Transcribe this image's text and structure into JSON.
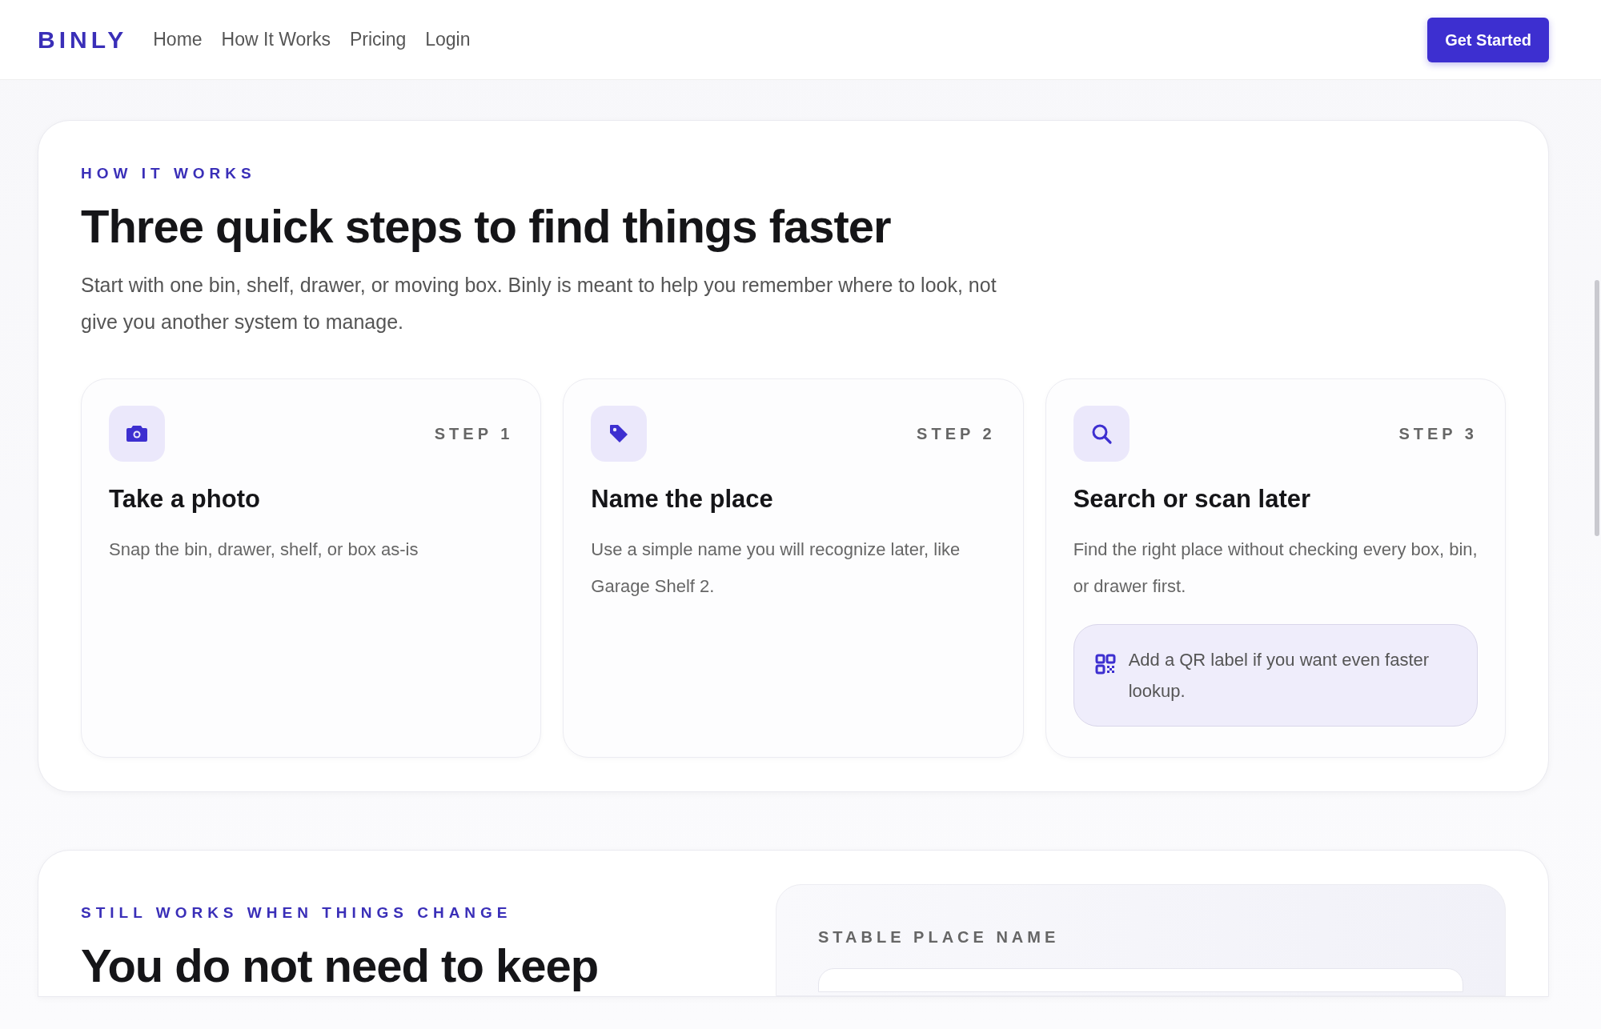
{
  "nav": {
    "brand": "BINLY",
    "links": [
      {
        "label": "Home"
      },
      {
        "label": "How It Works"
      },
      {
        "label": "Pricing"
      },
      {
        "label": "Login"
      }
    ],
    "cta": "Get Started"
  },
  "how_it_works": {
    "eyebrow": "HOW IT WORKS",
    "title": "Three quick steps to find things faster",
    "intro": "Start with one bin, shelf, drawer, or moving box. Binly is meant to help you remember where to look, not give you another system to manage.",
    "steps": [
      {
        "kind": "camera",
        "step": "STEP 1",
        "title": "Take a photo",
        "text": "Snap the bin, drawer, shelf, or box as-is"
      },
      {
        "kind": "tag",
        "step": "STEP 2",
        "title": "Name the place",
        "text": "Use a simple name you will recognize later, like Garage Shelf 2."
      },
      {
        "kind": "search",
        "step": "STEP 3",
        "title": "Search or scan later",
        "text": "Find the right place without checking every box, bin, or drawer first.",
        "tip": "Add a QR label if you want even faster lookup."
      }
    ]
  },
  "changes": {
    "eyebrow": "STILL WORKS WHEN THINGS CHANGE",
    "title": "You do not need to keep",
    "panel_label": "STABLE PLACE NAME"
  }
}
